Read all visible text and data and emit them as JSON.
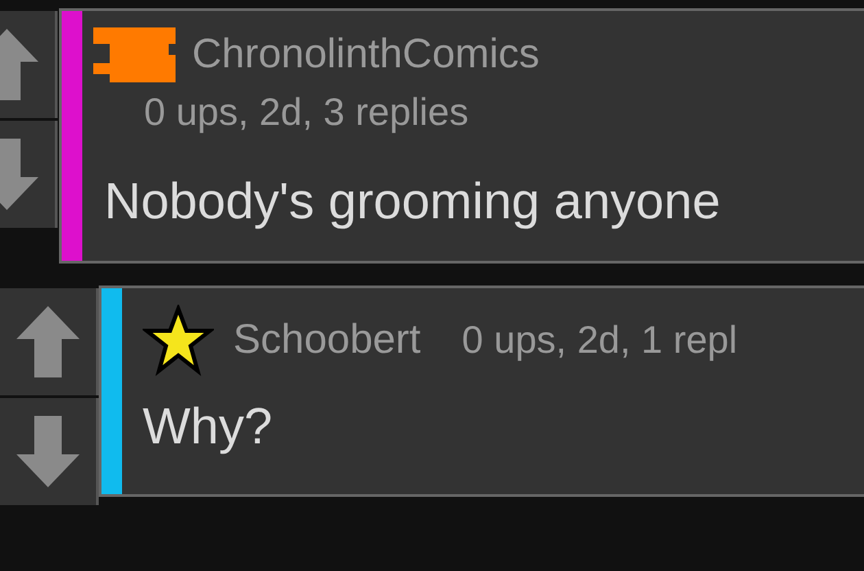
{
  "comments": [
    {
      "username": "ChronolinthComics",
      "meta": "0 ups, 2d, 3 replies",
      "text": "Nobody's grooming anyone",
      "color": "#dd10cc",
      "badge": {
        "kind": "block"
      }
    },
    {
      "username": "Schoobert",
      "meta": "0 ups, 2d, 1 repl",
      "text": "Why?",
      "color": "#10bbee",
      "badge": {
        "kind": "star"
      }
    }
  ]
}
